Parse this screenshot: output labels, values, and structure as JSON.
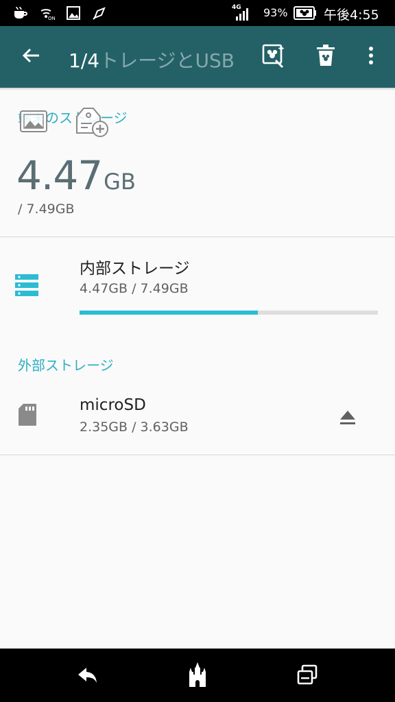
{
  "status_bar": {
    "network": "4G",
    "battery_percent": "93%",
    "time": "午後4:55",
    "icons": [
      "notification-cup-icon",
      "wifi-on-icon",
      "photo-icon",
      "rocket-icon",
      "signal-icon",
      "battery-icon"
    ]
  },
  "toolbar": {
    "counter": "1/4",
    "title": "トレージとUSB",
    "icons": [
      "back-arrow-icon",
      "photo-edit-icon",
      "trash-icon",
      "more-vert-icon"
    ]
  },
  "device_storage": {
    "label": "端末のストレージ",
    "used_value": "4.47",
    "used_unit": "GB",
    "total": "/ 7.49GB"
  },
  "internal_storage": {
    "title": "内部ストレージ",
    "usage": "4.47GB / 7.49GB",
    "progress_fraction": 0.597
  },
  "external_storage": {
    "label": "外部ストレージ",
    "title": "microSD",
    "usage": "2.35GB / 3.63GB"
  },
  "colors": {
    "toolbar": "#236167",
    "accent": "#2eaec2",
    "progress": "#2bbcd4"
  }
}
